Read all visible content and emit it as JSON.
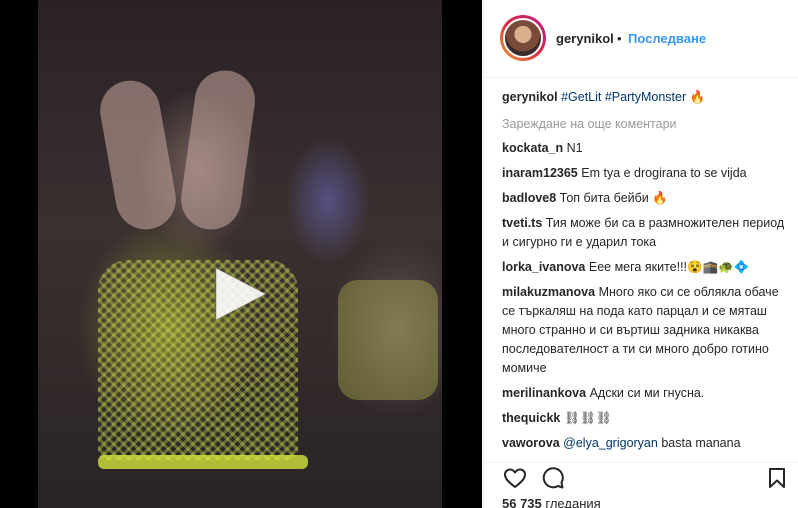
{
  "header": {
    "username": "gerynikol",
    "separator": "•",
    "follow_label": "Последване"
  },
  "caption": {
    "username": "gerynikol",
    "tag1": "#GetLit",
    "tag2": "#PartyMonster",
    "emoji": "🔥"
  },
  "load_more": "Зареждане на още коментари",
  "comments": [
    {
      "user": "kockata_n",
      "text": "N1"
    },
    {
      "user": "inaram12365",
      "text": "Em tya e drogirana to se vijda"
    },
    {
      "user": "badlove8",
      "text": "Топ бита бейби 🔥"
    },
    {
      "user": "tveti.ts",
      "text": "Тия може би са в размножителен период и сигурно ги е ударил тока"
    },
    {
      "user": "lorka_ivanova",
      "text": "Еее мега яките!!!😵🕋🐢💠"
    },
    {
      "user": "milakuzmanova",
      "text": "Много яко си се облякла обаче се търкаляш на пода като парцал и се мяташ много странно и си въртиш задника никаква последователност а ти си много добро готино момиче"
    },
    {
      "user": "merilinankova",
      "text": "Адски си ми гнусна."
    },
    {
      "user": "thequickk",
      "text": "⛓⛓⛓"
    },
    {
      "user": "vaworova",
      "mention": "@elya_grigoryan",
      "text": " basta manana"
    }
  ],
  "views": {
    "count": "56 735",
    "label": "гледания"
  },
  "icons": {
    "like": "heart-icon",
    "comment": "comment-icon",
    "save": "bookmark-icon",
    "play": "play-icon"
  },
  "colors": {
    "link_blue": "#3897f0",
    "hashtag": "#003569",
    "muted": "#999999"
  }
}
